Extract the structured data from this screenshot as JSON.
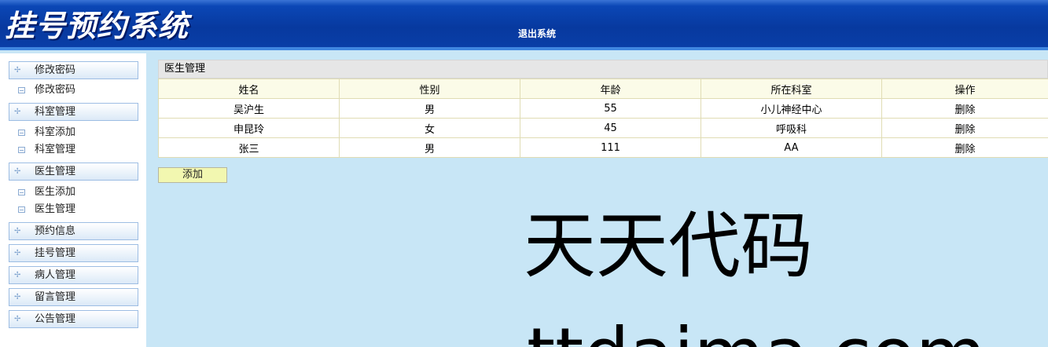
{
  "header": {
    "title": "挂号预约系统",
    "logout_label": "退出系统"
  },
  "sidebar": {
    "groups": [
      {
        "label": "修改密码",
        "items": [
          "修改密码"
        ]
      },
      {
        "label": "科室管理",
        "items": [
          "科室添加",
          "科室管理"
        ]
      },
      {
        "label": "医生管理",
        "items": [
          "医生添加",
          "医生管理"
        ]
      },
      {
        "label": "预约信息",
        "items": []
      },
      {
        "label": "挂号管理",
        "items": []
      },
      {
        "label": "病人管理",
        "items": []
      },
      {
        "label": "留言管理",
        "items": []
      },
      {
        "label": "公告管理",
        "items": []
      }
    ]
  },
  "panel": {
    "title": "医生管理",
    "columns": [
      "姓名",
      "性别",
      "年龄",
      "所在科室",
      "操作"
    ],
    "rows": [
      [
        "吴沪生",
        "男",
        "55",
        "小儿神经中心",
        "删除"
      ],
      [
        "申昆玲",
        "女",
        "45",
        "呼吸科",
        "删除"
      ],
      [
        "张三",
        "男",
        "111",
        "AA",
        "删除"
      ]
    ],
    "add_label": "添加"
  },
  "watermark": {
    "line1": "天天代码",
    "line2": "ttdaima.com"
  }
}
